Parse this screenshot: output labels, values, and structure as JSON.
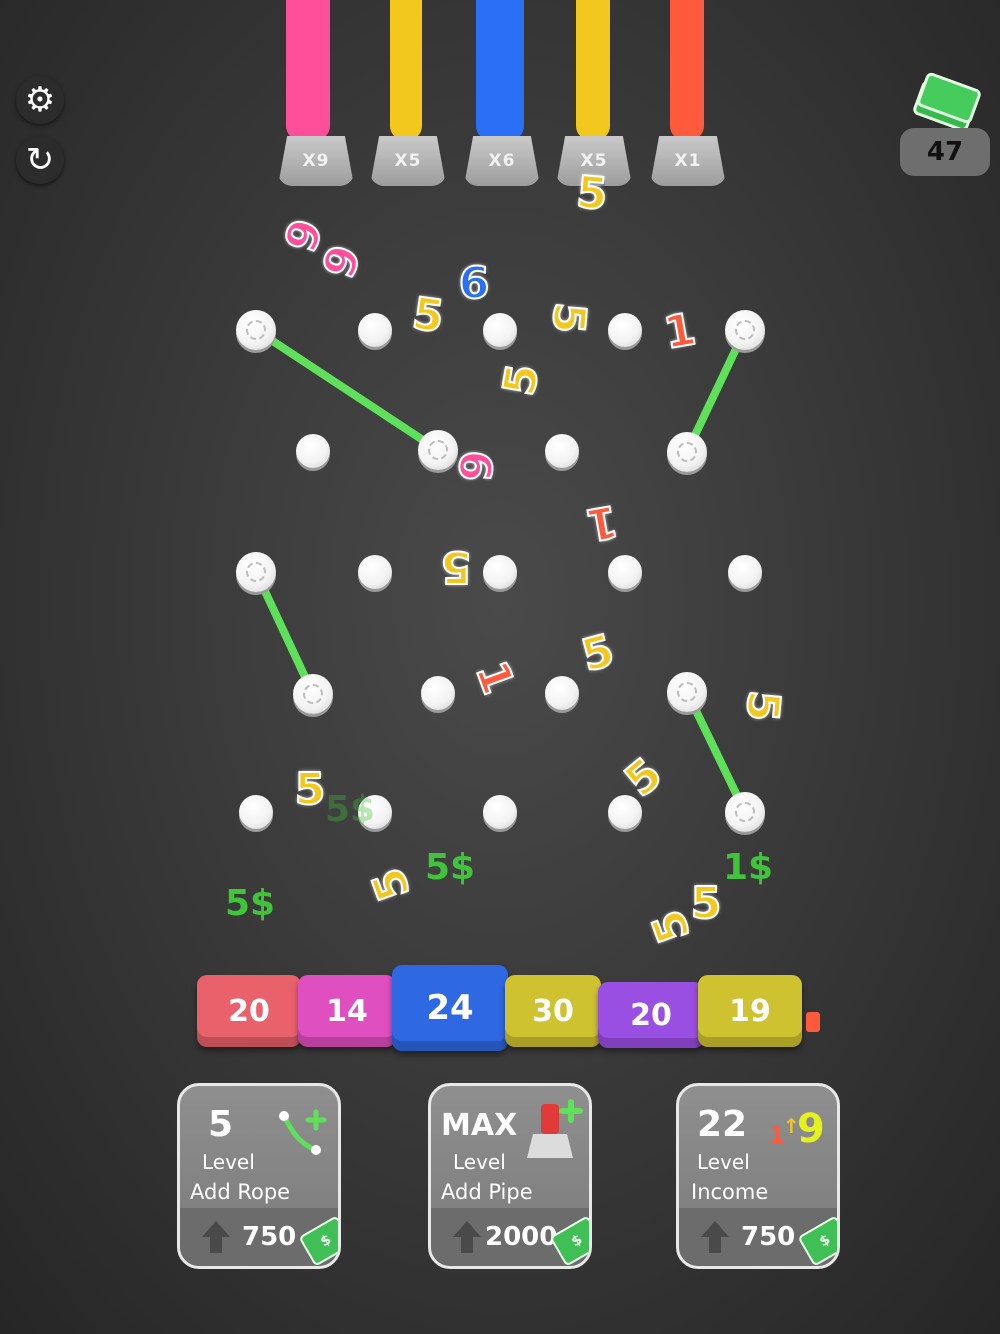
{
  "controls": {
    "settings_icon": "gear-icon",
    "restart_icon": "restart-icon"
  },
  "balance": {
    "amount": "47",
    "icon": "cash-stack-icon"
  },
  "pipes": [
    {
      "label": "X9",
      "color": "#ff4f9a"
    },
    {
      "label": "X5",
      "color": "#f2c81e"
    },
    {
      "label": "X6",
      "color": "#2a6ff5"
    },
    {
      "label": "X5",
      "color": "#f2c81e"
    },
    {
      "label": "X1",
      "color": "#ff5a3c"
    }
  ],
  "falling_numbers": [
    {
      "text": "5",
      "color": "#f2c81e"
    },
    {
      "text": "9",
      "color": "#ff4f9a"
    },
    {
      "text": "9",
      "color": "#ff4f9a"
    },
    {
      "text": "6",
      "color": "#2a6ff5"
    },
    {
      "text": "5",
      "color": "#f2c81e"
    },
    {
      "text": "5",
      "color": "#f2c81e"
    },
    {
      "text": "1",
      "color": "#ff5a3c"
    },
    {
      "text": "5",
      "color": "#f2c81e"
    },
    {
      "text": "9",
      "color": "#ff4f9a"
    },
    {
      "text": "1",
      "color": "#ff5a3c"
    },
    {
      "text": "5",
      "color": "#f2c81e"
    },
    {
      "text": "5",
      "color": "#f2c81e"
    },
    {
      "text": "1",
      "color": "#ff5a3c"
    },
    {
      "text": "5",
      "color": "#f2c81e"
    },
    {
      "text": "5",
      "color": "#f2c81e"
    },
    {
      "text": "5",
      "color": "#f2c81e"
    },
    {
      "text": "5",
      "color": "#f2c81e"
    },
    {
      "text": "5",
      "color": "#f2c81e"
    },
    {
      "text": "5",
      "color": "#f2c81e"
    }
  ],
  "earnings_popups": [
    "5$",
    "5$",
    "5$",
    "1$"
  ],
  "blocks": [
    {
      "value": "20",
      "color": "#e8616b"
    },
    {
      "value": "14",
      "color": "#e04fc0"
    },
    {
      "value": "24",
      "color": "#2f68e3"
    },
    {
      "value": "30",
      "color": "#cfc230"
    },
    {
      "value": "20",
      "color": "#9a4fe3"
    },
    {
      "value": "19",
      "color": "#cfc230"
    }
  ],
  "upgrades": [
    {
      "level": "5",
      "level_label": "Level",
      "action": "Add Rope",
      "cost": "750",
      "icon": "add-rope-icon"
    },
    {
      "level": "MAX",
      "level_label": "Level",
      "action": "Add Pipe",
      "cost": "2000",
      "icon": "add-pipe-icon"
    },
    {
      "level": "22",
      "level_label": "Level",
      "action": "Income",
      "cost": "750",
      "icon": "income-icon"
    }
  ],
  "colors": {
    "rope": "#5fe05a",
    "peg": "#f5f5f5",
    "card_border": "#e8e8e8"
  }
}
